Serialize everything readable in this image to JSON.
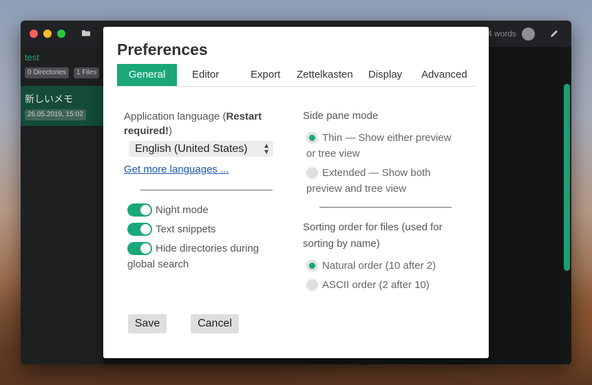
{
  "background": {
    "accent": "#1aa77a"
  },
  "app": {
    "word_count": "4 words",
    "sidebar": {
      "directory_name": "test",
      "badges": [
        "0 Directories",
        "1 Files"
      ],
      "note": {
        "title": "新しいメモ",
        "date": "26.05.2019, 15:02"
      }
    }
  },
  "preferences": {
    "title": "Preferences",
    "tabs": [
      "General",
      "Editor",
      "Export",
      "Zettelkasten",
      "Display",
      "Advanced"
    ],
    "active_tab": "General",
    "language": {
      "label_prefix": "Application language (",
      "label_bold": "Restart required!",
      "label_suffix": ")",
      "selected": "English (United States)",
      "more_link": "Get more languages ..."
    },
    "toggles": [
      {
        "label": "Night mode",
        "on": true
      },
      {
        "label": "Text snippets",
        "on": true
      },
      {
        "label_line1": "Hide directories during",
        "label_line2": "global search",
        "on": true
      }
    ],
    "side_pane": {
      "title": "Side pane mode",
      "options": [
        {
          "line1": "Thin — Show either preview",
          "line2": "or tree view",
          "selected": true
        },
        {
          "line1": "Extended — Show both",
          "line2": "preview and tree view",
          "selected": false
        }
      ]
    },
    "sorting": {
      "title_line1": "Sorting order for files (used for",
      "title_line2": "sorting by name)",
      "options": [
        {
          "label": "Natural order (10 after 2)",
          "selected": true
        },
        {
          "label": "ASCII order (2 after 10)",
          "selected": false
        }
      ]
    },
    "buttons": {
      "save": "Save",
      "cancel": "Cancel"
    }
  }
}
